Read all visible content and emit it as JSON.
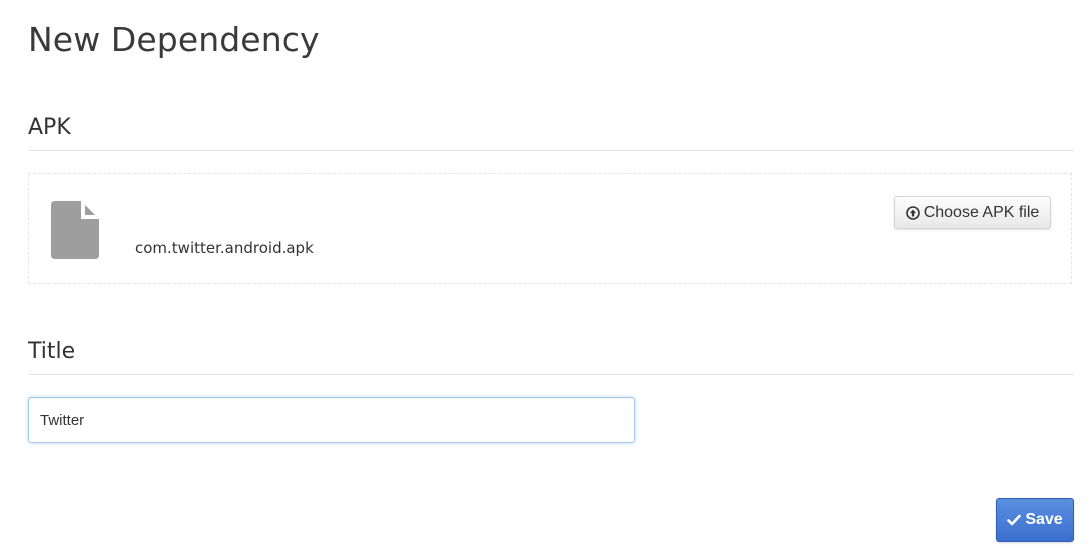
{
  "page": {
    "title": "New Dependency"
  },
  "apk_section": {
    "heading": "APK",
    "file_name": "com.twitter.android.apk",
    "file_icon": "file-icon",
    "choose_button": {
      "icon": "arrow-up-circle-icon",
      "label": "Choose APK file"
    }
  },
  "title_section": {
    "heading": "Title",
    "input_value": "Twitter",
    "input_placeholder": ""
  },
  "save_button": {
    "icon": "check-icon",
    "label": "Save"
  },
  "colors": {
    "primary": "#3b6fcf",
    "file_icon": "#9e9e9e",
    "input_focus": "#a9c9e8"
  }
}
